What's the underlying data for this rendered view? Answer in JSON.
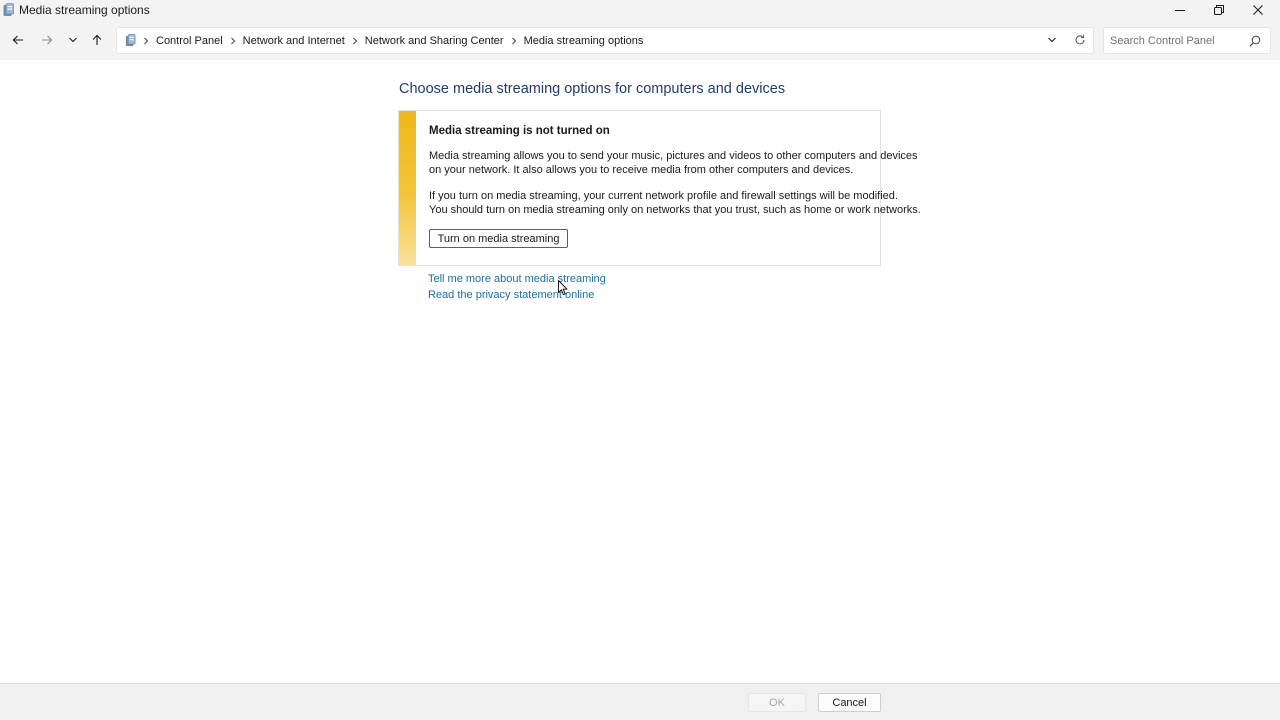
{
  "window": {
    "title": "Media streaming options",
    "icon": "control-panel-icon",
    "controls": [
      "minimize-icon",
      "restore-icon",
      "close-icon"
    ]
  },
  "nav": {
    "icons": [
      "back-arrow-icon",
      "forward-arrow-icon",
      "recent-locations-chevron-icon",
      "up-arrow-icon"
    ]
  },
  "address": {
    "icon": "control-panel-icon",
    "breadcrumbs": [
      "Control Panel",
      "Network and Internet",
      "Network and Sharing Center",
      "Media streaming options"
    ]
  },
  "search": {
    "placeholder": "Search Control Panel",
    "value": ""
  },
  "content": {
    "title": "Choose media streaming options for computers and devices",
    "warning": {
      "heading": "Media streaming is not turned on",
      "paragraph1_line1": "Media streaming allows you to send your music, pictures and videos to other computers and devices",
      "paragraph1_line2": "on your network.  It also allows you to receive media from other computers and devices.",
      "paragraph2_line1": "If you turn on media streaming, your current network profile and firewall settings will be modified.",
      "paragraph2_line2": "You should turn on media streaming only on networks that you trust, such as home or work networks.",
      "button_label": "Turn on media streaming",
      "stripe_color": "#f0b81a"
    },
    "links": [
      "Tell me more about media streaming",
      "Read the privacy statement online"
    ]
  },
  "footer": {
    "ok_label": "OK",
    "cancel_label": "Cancel"
  },
  "colors": {
    "title_blue": "#1e3d6e",
    "link_blue": "#1a6fa0",
    "button_border_teal": "#1e7a78"
  }
}
